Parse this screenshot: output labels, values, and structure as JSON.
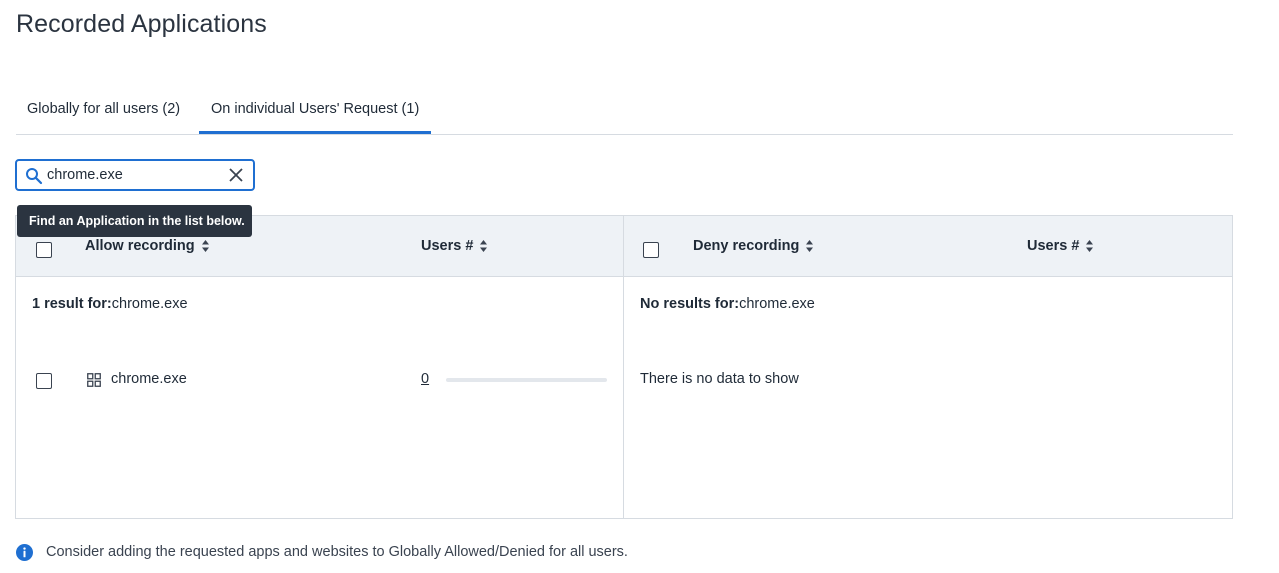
{
  "page": {
    "title": "Recorded Applications"
  },
  "tabs": [
    {
      "label": "Globally for all users (2)",
      "active": false
    },
    {
      "label": "On individual Users' Request (1)",
      "active": true
    }
  ],
  "search": {
    "value": "chrome.exe",
    "placeholder": "",
    "tooltip": "Find an Application in the list below."
  },
  "allow_panel": {
    "column_app": "Allow recording",
    "column_users": "Users #",
    "result_prefix": "1 result for:",
    "result_query": "chrome.exe",
    "rows": [
      {
        "name": "chrome.exe",
        "users": "0",
        "users_fraction": 0
      }
    ]
  },
  "deny_panel": {
    "column_app": "Deny recording",
    "column_users": "Users #",
    "result_prefix": "No results for:",
    "result_query": "chrome.exe",
    "empty_message": "There is no data to show"
  },
  "footer": {
    "info": "Consider adding the requested apps and websites to Globally Allowed/Denied for all users."
  },
  "colors": {
    "accent": "#1f6fd1",
    "header_bg": "#eef2f6",
    "tooltip_bg": "#2b3440",
    "border": "#d6dbe1"
  },
  "icons": {
    "search": "search-icon",
    "clear": "close-icon",
    "sort": "sort-icon",
    "app": "grid-icon",
    "info": "info-icon"
  }
}
